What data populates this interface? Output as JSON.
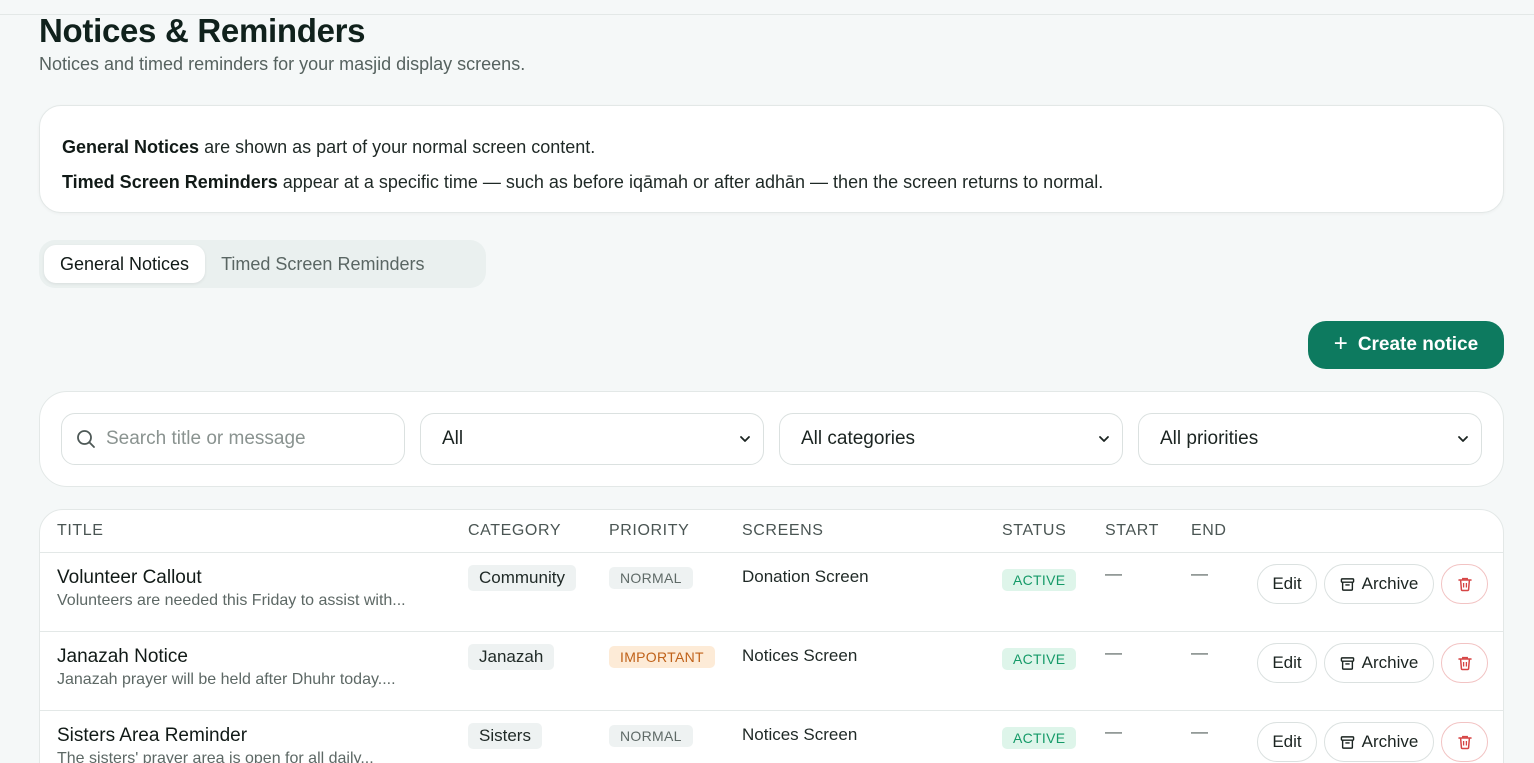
{
  "header": {
    "title": "Notices & Reminders",
    "subtitle": "Notices and timed reminders for your masjid display screens."
  },
  "info": {
    "line1_bold": "General Notices",
    "line1_rest": " are shown as part of your normal screen content.",
    "line2_bold": "Timed Screen Reminders",
    "line2_rest": " appear at a specific time — such as before iqāmah or after adhān — then the screen returns to normal."
  },
  "tabs": [
    {
      "label": "General Notices",
      "active": true
    },
    {
      "label": "Timed Screen Reminders",
      "active": false
    }
  ],
  "actions": {
    "create_label": "Create notice",
    "create_icon": "plus-icon"
  },
  "filters": {
    "search_placeholder": "Search title or message",
    "status_value": "All",
    "category_value": "All categories",
    "priority_value": "All priorities"
  },
  "table": {
    "columns": [
      "TITLE",
      "CATEGORY",
      "PRIORITY",
      "SCREENS",
      "STATUS",
      "START",
      "END"
    ],
    "rows": [
      {
        "title": "Volunteer Callout",
        "message": "Volunteers are needed this Friday to assist with...",
        "category": "Community",
        "priority": "NORMAL",
        "screens": "Donation Screen",
        "status": "ACTIVE",
        "start": "—",
        "end": "—"
      },
      {
        "title": "Janazah Notice",
        "message": "Janazah prayer will be held after Dhuhr today....",
        "category": "Janazah",
        "priority": "IMPORTANT",
        "screens": "Notices Screen",
        "status": "ACTIVE",
        "start": "—",
        "end": "—"
      },
      {
        "title": "Sisters Area Reminder",
        "message": "The sisters' prayer area is open for all daily...",
        "category": "Sisters",
        "priority": "NORMAL",
        "screens": "Notices Screen",
        "status": "ACTIVE",
        "start": "—",
        "end": "—"
      }
    ],
    "row_actions": {
      "edit": "Edit",
      "archive": "Archive"
    }
  },
  "colors": {
    "accent": "#0d7a5f",
    "important": "#c0621a",
    "active": "#159a68",
    "delete": "#d64545"
  }
}
